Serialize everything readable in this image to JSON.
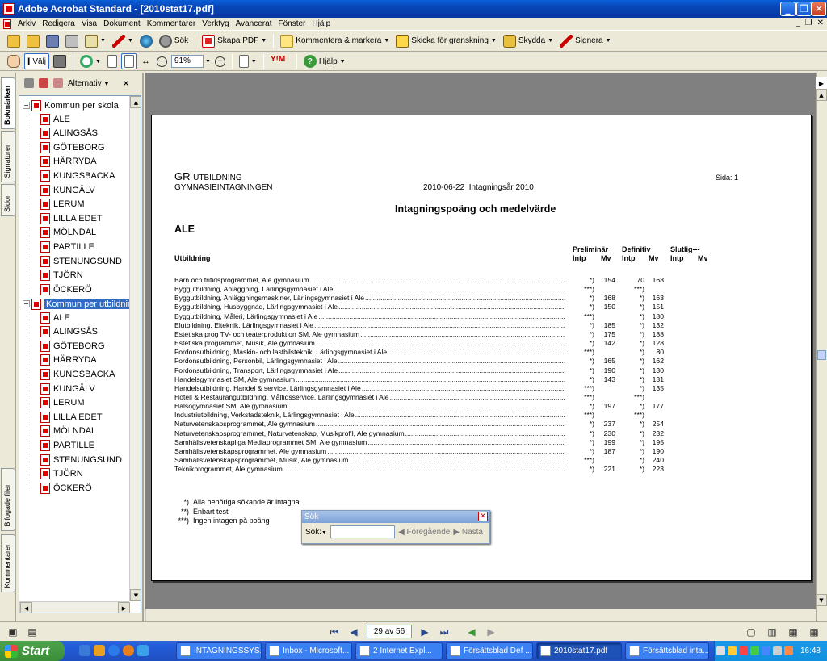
{
  "window": {
    "title": "Adobe Acrobat Standard - [2010stat17.pdf]"
  },
  "menu": [
    "Arkiv",
    "Redigera",
    "Visa",
    "Dokument",
    "Kommentarer",
    "Verktyg",
    "Avancerat",
    "Fönster",
    "Hjälp"
  ],
  "toolbar1": {
    "search": "Sök",
    "create_pdf": "Skapa PDF",
    "comment": "Kommentera & markera",
    "send_review": "Skicka för granskning",
    "secure": "Skydda",
    "sign": "Signera"
  },
  "toolbar2": {
    "select": "Välj",
    "zoom": "91%",
    "help": "Hjälp"
  },
  "side_tabs": [
    "Bokmärken",
    "Signaturer",
    "Sidor",
    "Bifogade filer",
    "Kommentarer"
  ],
  "bookmarks": {
    "options": "Alternativ",
    "group1": "Kommun per skola",
    "group2": "Kommun per utbildning",
    "items": [
      "ALE",
      "ALINGSÅS",
      "GÖTEBORG",
      "HÄRRYDA",
      "KUNGSBACKA",
      "KUNGÄLV",
      "LERUM",
      "LILLA EDET",
      "MÖLNDAL",
      "PARTILLE",
      "STENUNGSUND",
      "TJÖRN",
      "ÖCKERÖ"
    ]
  },
  "doc": {
    "org1": "GR",
    "org1b": "UTBILDNING",
    "org2": "GYMNASIEINTAGNINGEN",
    "date": "2010-06-22",
    "year": "Intagningsår 2010",
    "page": "Sida: 1",
    "title": "Intagningspoäng och medelvärde",
    "municipality": "ALE",
    "col_utb": "Utbildning",
    "h_prel": "Preliminär",
    "h_def": "Definitiv",
    "h_slut": "Slutlig---",
    "sub": [
      "Intp",
      "Mv",
      "Intp",
      "Mv",
      "Intp",
      "Mv"
    ],
    "rows": [
      {
        "name": "Barn och fritidsprogrammet,  Ale gymnasium",
        "pi": "*)",
        "pm": "154",
        "di": "70",
        "dm": "168"
      },
      {
        "name": "Byggutbildning, Anläggning,  Lärlingsgymnasiet i Ale",
        "pi": "***)",
        "pm": "",
        "di": "***)",
        "dm": ""
      },
      {
        "name": "Byggutbildning, Anläggningsmaskiner,  Lärlingsgymnasiet i Ale",
        "pi": "*)",
        "pm": "168",
        "di": "*)",
        "dm": "163"
      },
      {
        "name": "Byggutbildning, Husbyggnad,  Lärlingsgymnasiet i Ale",
        "pi": "*)",
        "pm": "150",
        "di": "*)",
        "dm": "151"
      },
      {
        "name": "Byggutbildning, Måleri,  Lärlingsgymnasiet i Ale",
        "pi": "***)",
        "pm": "",
        "di": "*)",
        "dm": "180"
      },
      {
        "name": "Elutbildning, Elteknik,  Lärlingsgymnasiet i Ale",
        "pi": "*)",
        "pm": "185",
        "di": "*)",
        "dm": "132"
      },
      {
        "name": "Estetiska prog TV- och teaterproduktion SM,  Ale gymnasium",
        "pi": "*)",
        "pm": "175",
        "di": "*)",
        "dm": "188"
      },
      {
        "name": "Estetiska programmet, Musik,  Ale gymnasium",
        "pi": "*)",
        "pm": "142",
        "di": "*)",
        "dm": "128"
      },
      {
        "name": "Fordonsutbildning, Maskin- och lastbilsteknik,  Lärlingsgymnasiet i Ale",
        "pi": "***)",
        "pm": "",
        "di": "*)",
        "dm": "80"
      },
      {
        "name": "Fordonsutbildning, Personbil,  Lärlingsgymnasiet i Ale",
        "pi": "*)",
        "pm": "165",
        "di": "*)",
        "dm": "162"
      },
      {
        "name": "Fordonsutbildning, Transport,  Lärlingsgymnasiet i Ale",
        "pi": "*)",
        "pm": "190",
        "di": "*)",
        "dm": "130"
      },
      {
        "name": "Handelsgymnasiet SM,  Ale gymnasium",
        "pi": "*)",
        "pm": "143",
        "di": "*)",
        "dm": "131"
      },
      {
        "name": "Handelsutbildning, Handel & service,  Lärlingsgymnasiet i Ale",
        "pi": "***)",
        "pm": "",
        "di": "*)",
        "dm": "135"
      },
      {
        "name": "Hotell & Restaurangutbildning, Måltidsservice,  Lärlingsgymnasiet i Ale",
        "pi": "***)",
        "pm": "",
        "di": "***)",
        "dm": ""
      },
      {
        "name": "Hälsogymnasiet SM,  Ale gymnasium",
        "pi": "*)",
        "pm": "197",
        "di": "*)",
        "dm": "177"
      },
      {
        "name": "Industriutbildning, Verkstadsteknik,  Lärlingsgymnasiet i Ale",
        "pi": "***)",
        "pm": "",
        "di": "***)",
        "dm": ""
      },
      {
        "name": "Naturvetenskapsprogrammet,  Ale gymnasium",
        "pi": "*)",
        "pm": "237",
        "di": "*)",
        "dm": "254"
      },
      {
        "name": "Naturvetenskapsprogrammet, Naturvetenskap, Musikprofil,  Ale gymnasium",
        "pi": "*)",
        "pm": "230",
        "di": "*)",
        "dm": "232"
      },
      {
        "name": "Samhällsvetenskapliga Mediaprogrammet SM,  Ale gymnasium",
        "pi": "*)",
        "pm": "199",
        "di": "*)",
        "dm": "195"
      },
      {
        "name": "Samhällsvetenskapsprogrammet,  Ale gymnasium",
        "pi": "*)",
        "pm": "187",
        "di": "*)",
        "dm": "190"
      },
      {
        "name": "Samhällsvetenskapsprogrammet, Musik,  Ale gymnasium",
        "pi": "***)",
        "pm": "",
        "di": "*)",
        "dm": "240"
      },
      {
        "name": "Teknikprogrammet,  Ale gymnasium",
        "pi": "*)",
        "pm": "221",
        "di": "*)",
        "dm": "223"
      }
    ],
    "legend": [
      {
        "sym": "*)",
        "text": "Alla behöriga sökande är intagna"
      },
      {
        "sym": "**)",
        "text": "Enbart test"
      },
      {
        "sym": "***)",
        "text": "Ingen intagen på poäng"
      }
    ]
  },
  "search_popup": {
    "title": "Sök",
    "label": "Sök:",
    "prev": "Föregående",
    "next": "Nästa",
    "value": ""
  },
  "nav": {
    "page": "29 av 56"
  },
  "taskbar": {
    "start": "Start",
    "items": [
      "INTAGNINGSSYS...",
      "Inbox - Microsoft...",
      "2 Internet Expl...",
      "Försättsblad Def ...",
      "2010stat17.pdf",
      "Försättsblad inta..."
    ],
    "clock": "16:48"
  }
}
